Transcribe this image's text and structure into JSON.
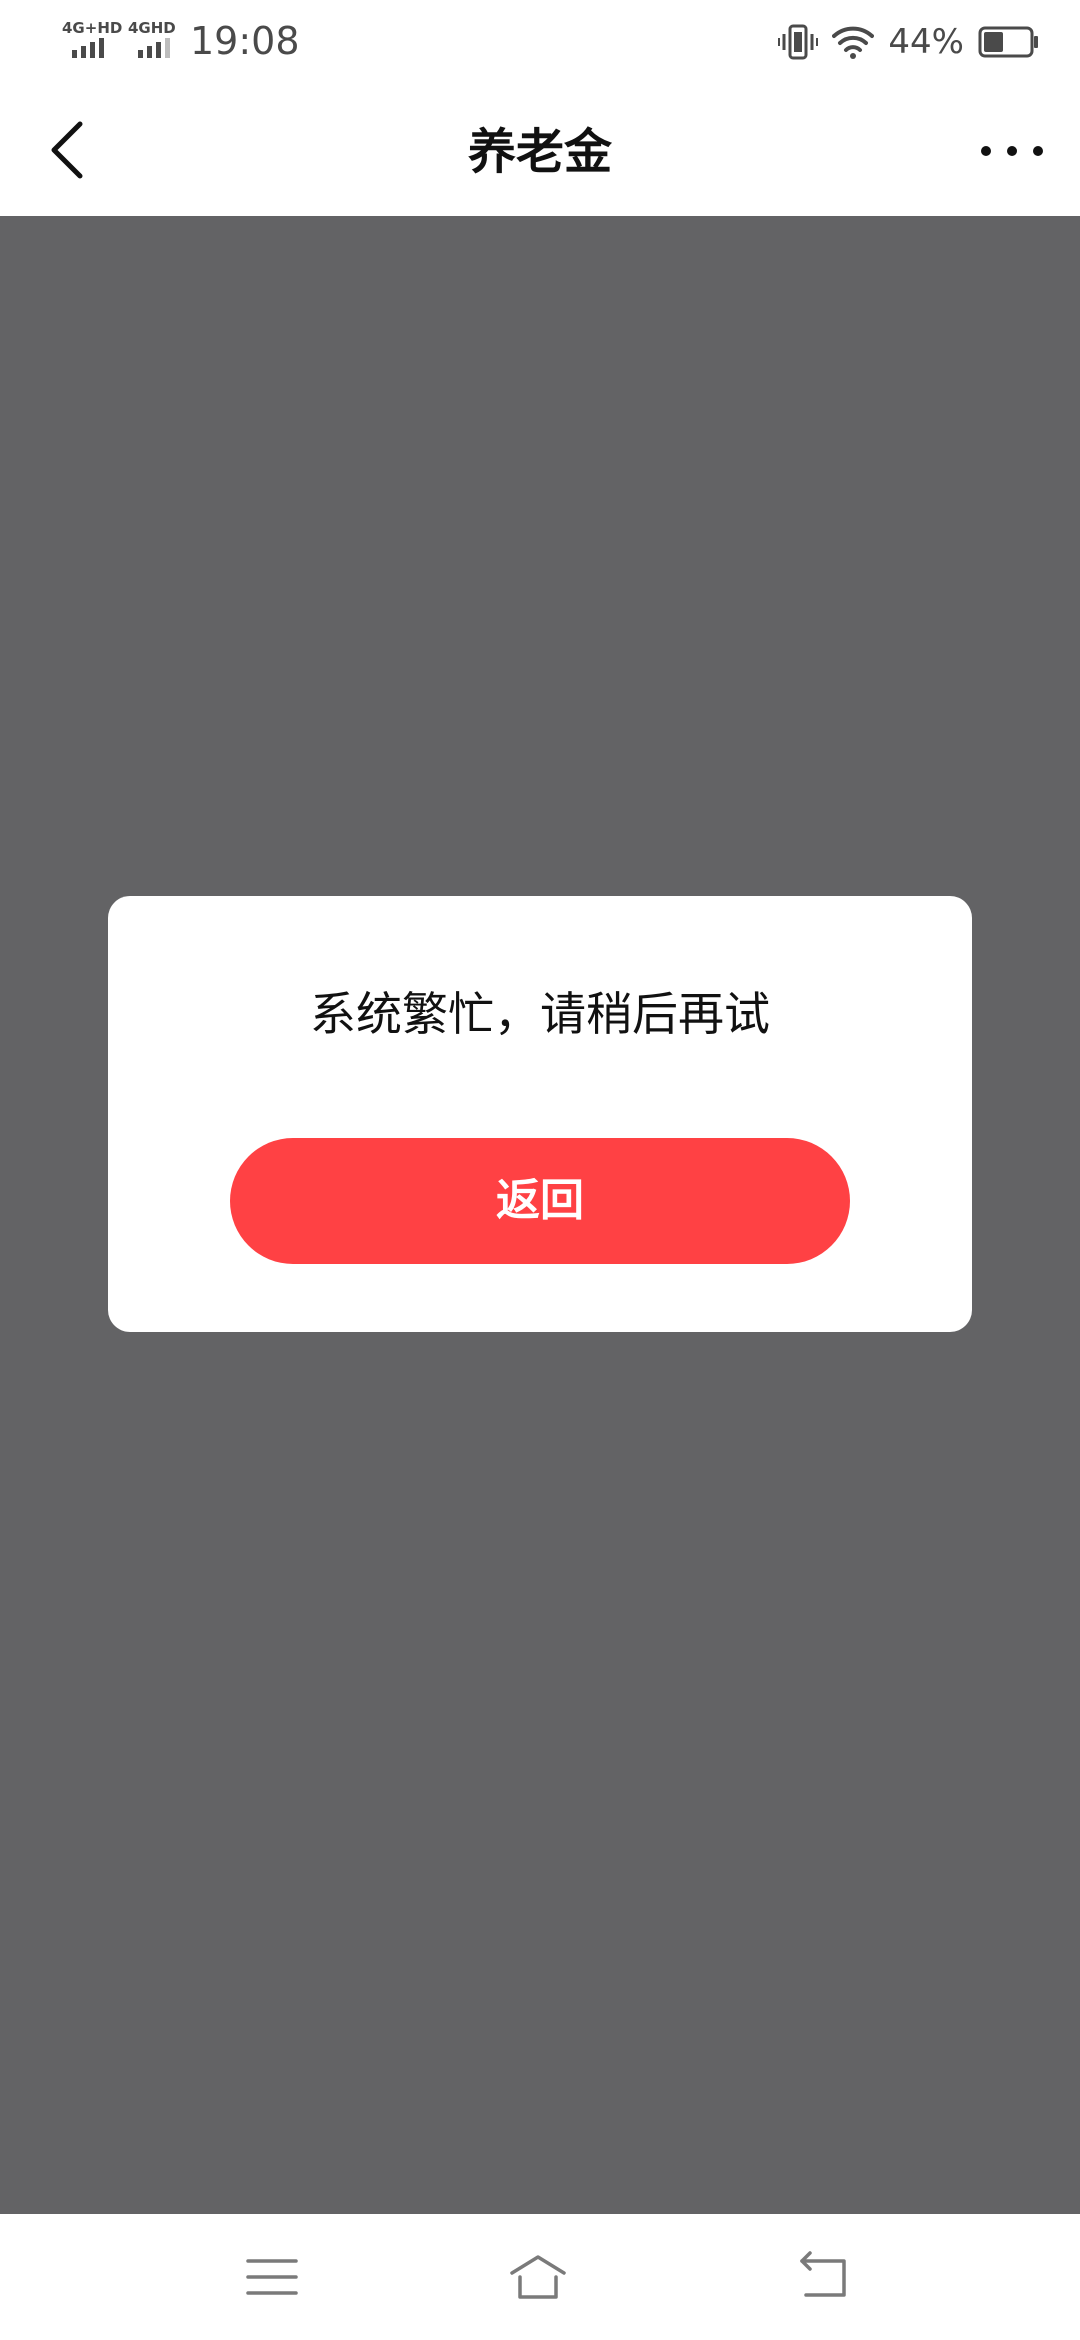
{
  "status_bar": {
    "sim1_label": "4G+HD",
    "sim2_label": "4GHD",
    "time": "19:08",
    "battery_percent": "44%",
    "battery_level": 0.44,
    "icons": [
      "vibrate-icon",
      "wifi-icon",
      "battery-icon"
    ]
  },
  "nav_bar": {
    "title": "养老金",
    "back_icon": "chevron-left-icon",
    "more_icon": "more-dots-icon"
  },
  "dialog": {
    "message": "系统繁忙，请稍后再试",
    "button_label": "返回",
    "button_color": "#ff4144"
  },
  "system_nav": {
    "icons": [
      "menu-icon",
      "home-icon",
      "back-icon"
    ]
  },
  "colors": {
    "overlay": "#636365",
    "text": "#111111",
    "status_text": "#4a4a4a"
  }
}
